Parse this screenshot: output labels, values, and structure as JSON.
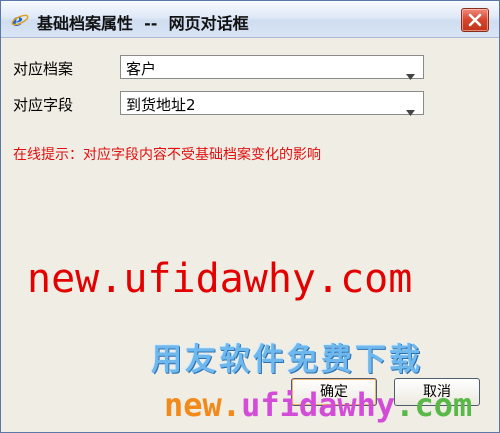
{
  "window": {
    "title": "基础档案属性  --  网页对话框"
  },
  "form": {
    "archive": {
      "label": "对应档案",
      "value": "客户"
    },
    "field": {
      "label": "对应字段",
      "value": "到货地址2"
    },
    "hint": "在线提示：对应字段内容不受基础档案变化的影响"
  },
  "buttons": {
    "ok_label": "确定",
    "cancel_label": "取消"
  },
  "watermark": {
    "url_top": "new.ufidawhy.com",
    "brand": "用友软件免费下载",
    "url_bottom_a": "new.",
    "url_bottom_b": "ufidawhy",
    "url_bottom_c": ".com"
  },
  "icons": {
    "title_icon": "ie-icon",
    "close_icon": "close-icon",
    "dropdown_icon": "chevron-down-icon"
  },
  "colors": {
    "hint": "#e01010",
    "watermark_red": "#e30000",
    "watermark_blue": "#6fb8ee",
    "watermark_orange": "#f28a1b",
    "watermark_purple": "#d24cd8",
    "watermark_green": "#58b848",
    "close_button": "#d6442d"
  }
}
